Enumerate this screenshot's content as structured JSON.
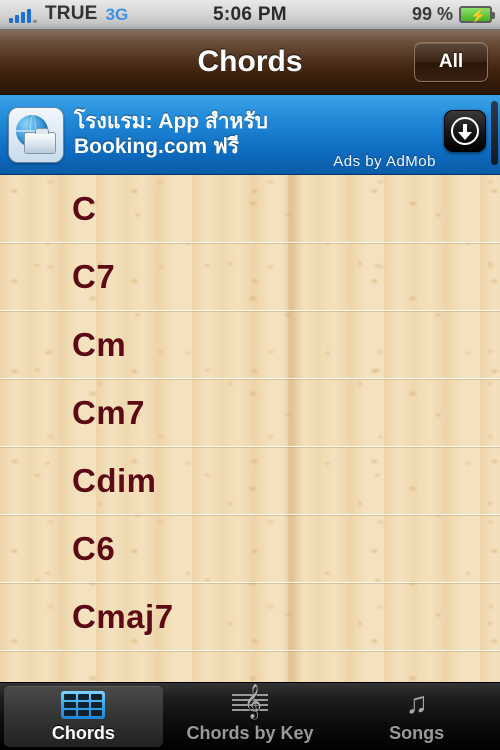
{
  "status_bar": {
    "signal_icon": "signal-bars-icon",
    "carrier": "TRUE",
    "network": "3G",
    "time": "5:06 PM",
    "battery_percent": "99 %",
    "battery_icon": "battery-charging-icon"
  },
  "nav": {
    "title": "Chords",
    "right_button": "All"
  },
  "ad": {
    "icon": "globe-suitcase-icon",
    "line1": "โรงแรม: App สำหรับ",
    "line2": "Booking.com ฟรี",
    "attribution": "Ads by AdMob",
    "download_icon": "download-circle-icon"
  },
  "list": {
    "rows": [
      {
        "label": "C"
      },
      {
        "label": "C7"
      },
      {
        "label": "Cm"
      },
      {
        "label": "Cm7"
      },
      {
        "label": "Cdim"
      },
      {
        "label": "C6"
      },
      {
        "label": "Cmaj7"
      }
    ]
  },
  "tabs": [
    {
      "label": "Chords",
      "icon": "chord-grid-icon",
      "active": true
    },
    {
      "label": "Chords by Key",
      "icon": "music-staff-icon",
      "active": false
    },
    {
      "label": "Songs",
      "icon": "music-note-icon",
      "active": false
    }
  ],
  "colors": {
    "nav_brown": "#3a1f0c",
    "chord_text": "#5c0b14",
    "ad_blue": "#1f86d6",
    "tab_active_blue": "#34a6ef",
    "paper_bg": "#f3e0bb"
  }
}
